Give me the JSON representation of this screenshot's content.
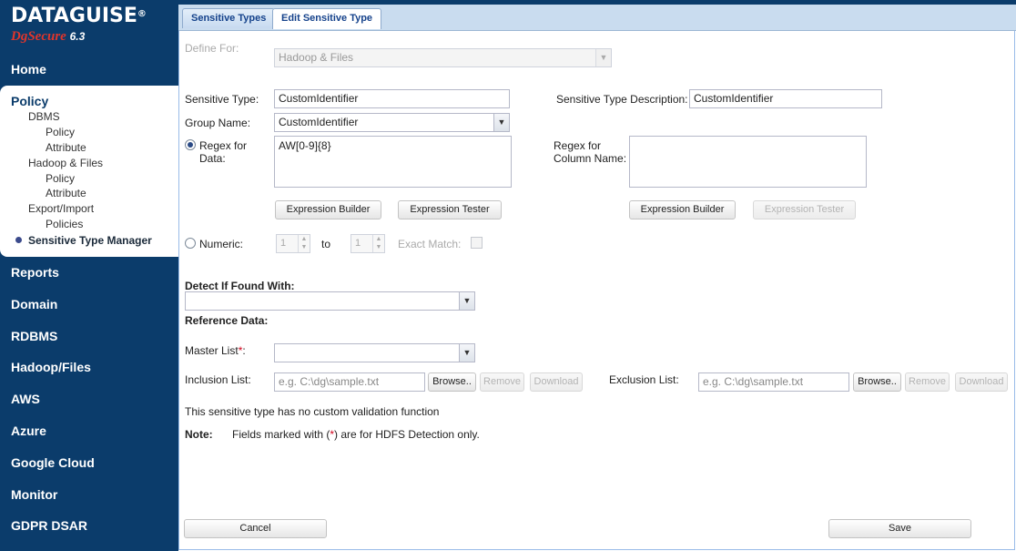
{
  "sidebar": {
    "logo": {
      "brand": "DATAGUISE",
      "reg": "®",
      "product": "DgSecure",
      "version": "6.3"
    },
    "home": "Home",
    "policy": {
      "title": "Policy",
      "items": [
        {
          "label": "DBMS",
          "level": 1
        },
        {
          "label": "Policy",
          "level": 2
        },
        {
          "label": "Attribute",
          "level": 2
        },
        {
          "label": "Hadoop & Files",
          "level": 1
        },
        {
          "label": "Policy",
          "level": 2
        },
        {
          "label": "Attribute",
          "level": 2
        },
        {
          "label": "Export/Import",
          "level": 1
        },
        {
          "label": "Policies",
          "level": 2
        }
      ],
      "active": "Sensitive Type Manager"
    },
    "nav": [
      "Reports",
      "Domain",
      "RDBMS",
      "Hadoop/Files",
      "AWS",
      "Azure",
      "Google Cloud",
      "Monitor",
      "GDPR DSAR"
    ]
  },
  "tabs": [
    "Sensitive Types",
    "Edit Sensitive Type"
  ],
  "form": {
    "define_for_label": "Define For:",
    "define_for_value": "Hadoop & Files",
    "sensitive_type_label": "Sensitive Type:",
    "sensitive_type_value": "CustomIdentifier",
    "description_label": "Sensitive Type Description:",
    "description_value": "CustomIdentifier",
    "group_name_label": "Group Name:",
    "group_name_value": "CustomIdentifier",
    "regex_data_label_1": "Regex for",
    "regex_data_label_2": "Data:",
    "regex_data_value": "AW[0-9]{8}",
    "regex_column_label_1": "Regex for",
    "regex_column_label_2": "Column Name:",
    "regex_column_value": "",
    "expression_builder": "Expression Builder",
    "expression_tester": "Expression Tester",
    "numeric_label": "Numeric:",
    "numeric_from": "1",
    "to_label": "to",
    "numeric_to": "1",
    "exact_match_label": "Exact Match:",
    "detect_label": "Detect If Found With:",
    "reference_label": "Reference Data:",
    "master_list_label": "Master List",
    "req_star": "*",
    "colon": ":",
    "inclusion_label": "Inclusion List:",
    "exclusion_label": "Exclusion List:",
    "path_placeholder": "e.g. C:\\dg\\sample.txt",
    "browse": "Browse..",
    "remove": "Remove",
    "download": "Download",
    "validation_note": "This sensitive type has no custom validation function",
    "note_label": "Note:",
    "note_text_1": "Fields marked with (",
    "note_text_2": ") are for HDFS Detection only.",
    "cancel": "Cancel",
    "save": "Save"
  },
  "colors": {
    "sidebar_bg": "#0b3c6b",
    "logo_accent": "#e0352b",
    "required": "#d0021b",
    "tab_text": "#15428b"
  }
}
